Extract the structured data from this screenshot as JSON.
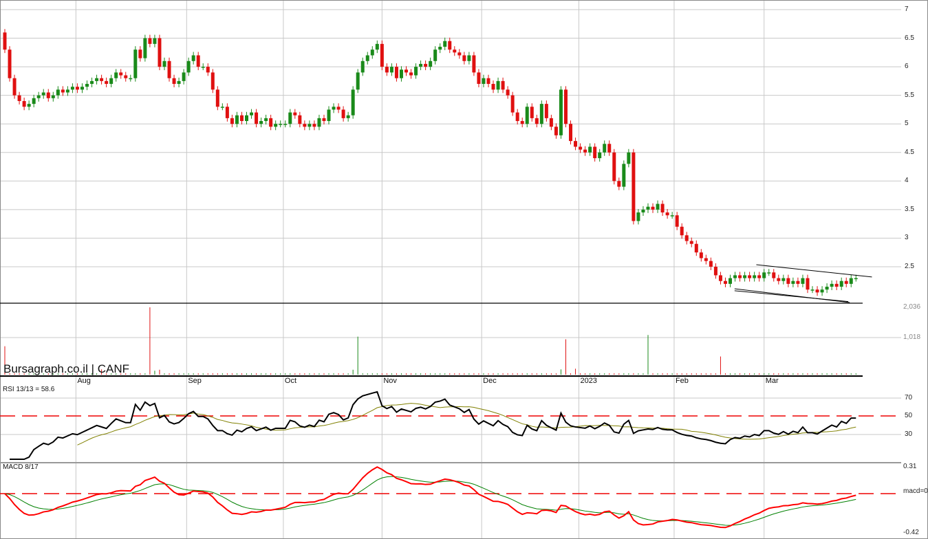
{
  "chart_data": {
    "type": "candlestick",
    "title": "Bursagraph.co.il | CANF",
    "price_axis": {
      "ticks": [
        "7",
        "6.5",
        "6",
        "5.5",
        "5",
        "4.5",
        "4",
        "3.5",
        "3",
        "2.5"
      ],
      "ylim": [
        2.5,
        7
      ]
    },
    "close": [
      6.3,
      5.8,
      5.5,
      5.4,
      5.3,
      5.35,
      5.45,
      5.5,
      5.55,
      5.45,
      5.5,
      5.6,
      5.55,
      5.6,
      5.65,
      5.6,
      5.65,
      5.7,
      5.75,
      5.8,
      5.75,
      5.7,
      5.8,
      5.9,
      5.85,
      5.8,
      5.8,
      6.3,
      6.15,
      6.5,
      6.4,
      6.5,
      6.0,
      6.1,
      5.8,
      5.7,
      5.75,
      5.9,
      6.1,
      6.2,
      6.0,
      6.0,
      5.9,
      5.6,
      5.3,
      5.3,
      5.1,
      5.0,
      5.15,
      5.05,
      5.15,
      5.2,
      5.0,
      5.05,
      5.1,
      4.95,
      5.0,
      5.0,
      5.0,
      5.2,
      5.15,
      5.0,
      4.95,
      5.0,
      4.95,
      5.1,
      5.05,
      5.25,
      5.3,
      5.25,
      5.1,
      5.15,
      5.6,
      5.9,
      6.1,
      6.2,
      6.3,
      6.4,
      6.0,
      5.9,
      6.0,
      5.8,
      5.95,
      5.9,
      5.85,
      6.0,
      6.05,
      6.0,
      6.1,
      6.3,
      6.35,
      6.45,
      6.3,
      6.25,
      6.2,
      6.1,
      6.2,
      5.9,
      5.7,
      5.8,
      5.7,
      5.6,
      5.75,
      5.6,
      5.5,
      5.2,
      5.05,
      5.0,
      5.3,
      5.1,
      5.0,
      5.35,
      5.1,
      4.95,
      4.8,
      5.6,
      5.0,
      4.7,
      4.6,
      4.55,
      4.5,
      4.6,
      4.4,
      4.5,
      4.65,
      4.5,
      4.0,
      3.9,
      4.3,
      4.5,
      3.3,
      3.45,
      3.5,
      3.55,
      3.5,
      3.6,
      3.45,
      3.4,
      3.4,
      3.2,
      3.05,
      2.95,
      2.9,
      2.75,
      2.65,
      2.6,
      2.5,
      2.35,
      2.25,
      2.2,
      2.3,
      2.35,
      2.3,
      2.35,
      2.3,
      2.35,
      2.3,
      2.4,
      2.4,
      2.3,
      2.25,
      2.3,
      2.2,
      2.25,
      2.2,
      2.3,
      2.1,
      2.1,
      2.05,
      2.1,
      2.15,
      2.2,
      2.15,
      2.25,
      2.2,
      2.3,
      2.3
    ],
    "first_open": 6.6,
    "trendlines": [
      {
        "from": [
          155.4,
          2.535
        ],
        "to": [
          179.3,
          2.32
        ]
      },
      {
        "from": [
          150.9,
          2.114
        ],
        "to": [
          174.7,
          1.874
        ]
      },
      {
        "from": [
          150.9,
          2.08
        ],
        "to": [
          174.4,
          1.89
        ]
      }
    ],
    "months": [
      {
        "label": "Aug",
        "index": 14.7
      },
      {
        "label": "Sep",
        "index": 37.6
      },
      {
        "label": "Oct",
        "index": 57.6
      },
      {
        "label": "Nov",
        "index": 78
      },
      {
        "label": "Dec",
        "index": 98.6
      },
      {
        "label": "2023",
        "index": 118.7
      },
      {
        "label": "Feb",
        "index": 138.4
      },
      {
        "label": "Mar",
        "index": 157
      }
    ],
    "volume": {
      "ticks": [
        "2,036",
        "1,018"
      ],
      "max": 2036,
      "default": 40,
      "spikes": [
        [
          0,
          860
        ],
        [
          30,
          2036
        ],
        [
          31,
          120
        ],
        [
          32,
          150
        ],
        [
          73,
          1150
        ],
        [
          116,
          1070
        ],
        [
          118,
          180
        ],
        [
          133,
          1200
        ],
        [
          148,
          550
        ],
        [
          20,
          160
        ],
        [
          72,
          150
        ],
        [
          115,
          160
        ]
      ]
    },
    "rsi": {
      "label": "RSI 13/13 = 58.6",
      "period": 13,
      "ticks": [
        "70",
        "50",
        "30"
      ],
      "level": 50
    },
    "macd": {
      "label": "MACD 8/17",
      "fast": 8,
      "slow": 17,
      "ticks": [
        "0.31",
        "macd=0",
        "-0.42"
      ],
      "ylim": [
        -0.42,
        0.31
      ]
    },
    "colors": {
      "up": "#1a8a1a",
      "down": "#e01010",
      "rsi": "#000000",
      "rsi_avg": "#808000",
      "macd": "#ff0000",
      "signal": "#008000"
    }
  }
}
